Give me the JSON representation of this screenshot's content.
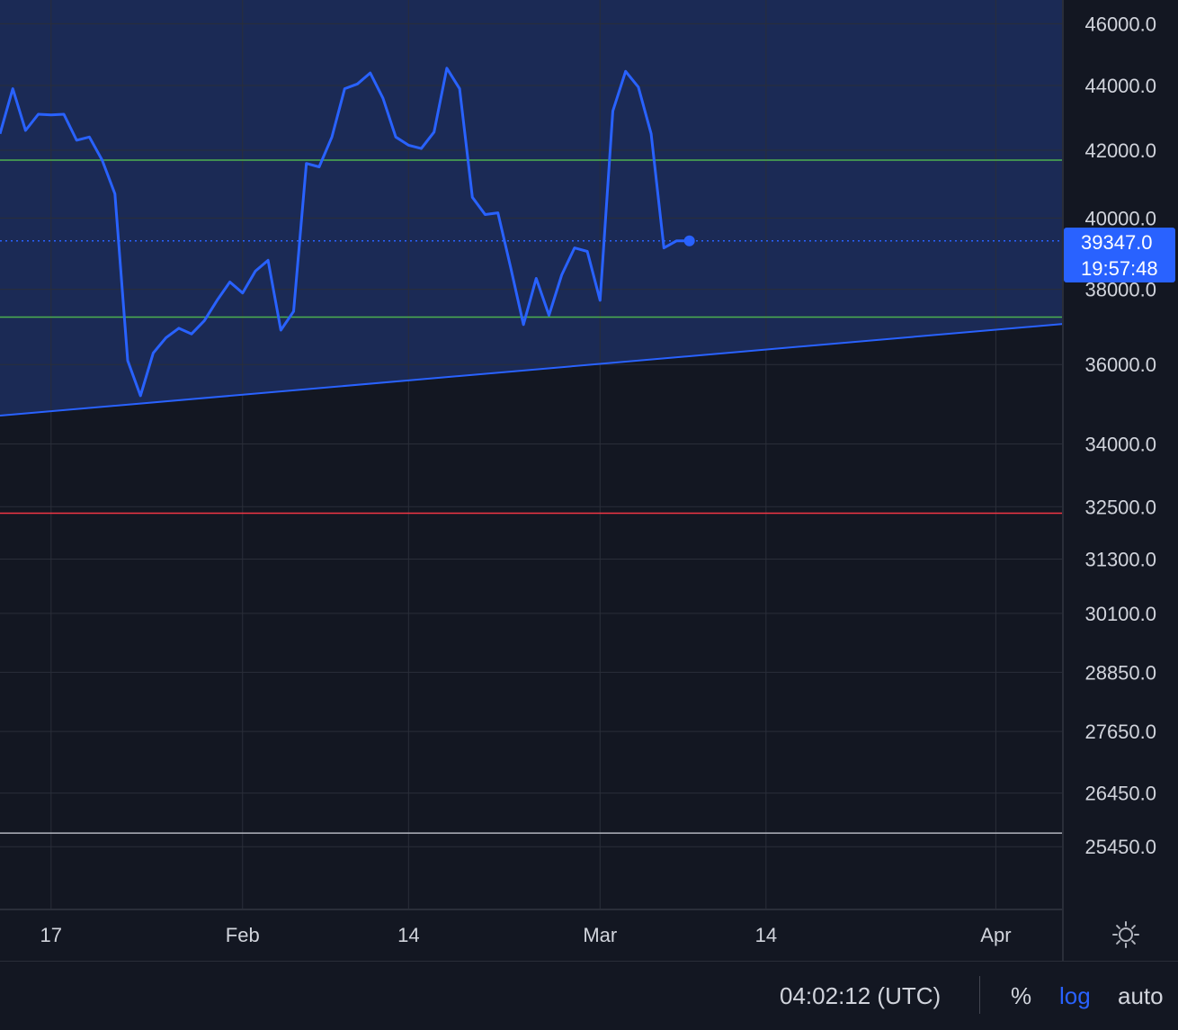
{
  "chart_data": {
    "type": "line",
    "scale": "log",
    "grid": true,
    "y_ticks": [
      "46000.0",
      "44000.0",
      "42000.0",
      "40000.0",
      "38000.0",
      "36000.0",
      "34000.0",
      "32500.0",
      "31300.0",
      "30100.0",
      "28850.0",
      "27650.0",
      "26450.0",
      "25450.0"
    ],
    "x_ticks": [
      "17",
      "Feb",
      "14",
      "Mar",
      "14",
      "Apr"
    ],
    "ylim": [
      24900,
      46700
    ],
    "xlim": [
      "2022-01-13",
      "2022-04-04"
    ],
    "series": [
      {
        "color": "#2962ff",
        "points": [
          [
            "2022-01-13",
            42500
          ],
          [
            "2022-01-14",
            43900
          ],
          [
            "2022-01-15",
            42600
          ],
          [
            "2022-01-16",
            43100
          ],
          [
            "2022-01-17",
            43080
          ],
          [
            "2022-01-18",
            43100
          ],
          [
            "2022-01-19",
            42300
          ],
          [
            "2022-01-20",
            42400
          ],
          [
            "2022-01-21",
            41700
          ],
          [
            "2022-01-22",
            40700
          ],
          [
            "2022-01-23",
            36100
          ],
          [
            "2022-01-24",
            35200
          ],
          [
            "2022-01-25",
            36300
          ],
          [
            "2022-01-26",
            36700
          ],
          [
            "2022-01-27",
            36950
          ],
          [
            "2022-01-28",
            36800
          ],
          [
            "2022-01-29",
            37150
          ],
          [
            "2022-01-30",
            37700
          ],
          [
            "2022-01-31",
            38200
          ],
          [
            "2022-02-01",
            37900
          ],
          [
            "2022-02-02",
            38500
          ],
          [
            "2022-02-03",
            38800
          ],
          [
            "2022-02-04",
            36900
          ],
          [
            "2022-02-05",
            37400
          ],
          [
            "2022-02-06",
            41600
          ],
          [
            "2022-02-07",
            41500
          ],
          [
            "2022-02-08",
            42400
          ],
          [
            "2022-02-09",
            43900
          ],
          [
            "2022-02-10",
            44050
          ],
          [
            "2022-02-11",
            44400
          ],
          [
            "2022-02-12",
            43600
          ],
          [
            "2022-02-13",
            42400
          ],
          [
            "2022-02-14",
            42150
          ],
          [
            "2022-02-15",
            42050
          ],
          [
            "2022-02-16",
            42550
          ],
          [
            "2022-02-17",
            44550
          ],
          [
            "2022-02-18",
            43900
          ],
          [
            "2022-02-19",
            40600
          ],
          [
            "2022-02-20",
            40100
          ],
          [
            "2022-02-21",
            40150
          ],
          [
            "2022-02-22",
            38600
          ],
          [
            "2022-02-23",
            37050
          ],
          [
            "2022-02-24",
            38300
          ],
          [
            "2022-02-25",
            37300
          ],
          [
            "2022-02-26",
            38400
          ],
          [
            "2022-02-27",
            39150
          ],
          [
            "2022-02-28",
            39050
          ],
          [
            "2022-03-01",
            37700
          ],
          [
            "2022-03-02",
            43200
          ],
          [
            "2022-03-03",
            44450
          ],
          [
            "2022-03-04",
            43950
          ],
          [
            "2022-03-05",
            42500
          ],
          [
            "2022-03-06",
            39150
          ],
          [
            "2022-03-07",
            39350
          ],
          [
            "2022-03-08",
            39347
          ]
        ]
      }
    ],
    "last_price": "39347.0",
    "countdown": "19:57:48",
    "overlays": {
      "trendline": {
        "color": "#2962ff",
        "from": [
          "2022-01-13",
          34700
        ],
        "to": [
          "2022-04-04",
          37000
        ],
        "fill": "#1b2a55"
      },
      "hlines": [
        {
          "value": 41700,
          "color": "#4caf50"
        },
        {
          "value": 37250,
          "color": "#4caf50"
        },
        {
          "value": 32350,
          "color": "#f23645"
        },
        {
          "value": 25700,
          "color": "#b2b5be"
        }
      ]
    }
  },
  "bottom_bar": {
    "time": "04:02:12 (UTC)",
    "percent_label": "%",
    "log_label": "log",
    "auto_label": "auto"
  },
  "icons": {
    "settings": "gear-icon"
  }
}
